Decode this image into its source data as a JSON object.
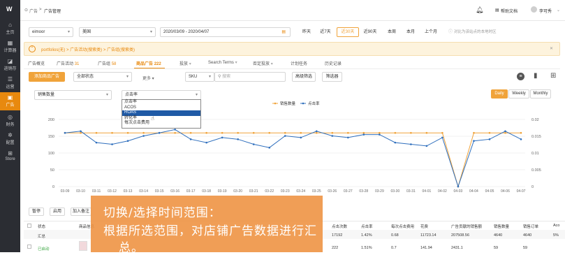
{
  "sidebar": {
    "logo": "W",
    "items": [
      {
        "label": "主页",
        "icon": "home-icon"
      },
      {
        "label": "计算器",
        "icon": "calculator-icon"
      },
      {
        "label": "进销存",
        "icon": "inventory-icon"
      },
      {
        "label": "运营",
        "icon": "operation-icon"
      },
      {
        "label": "广告",
        "icon": "megaphone-icon"
      },
      {
        "label": "财务",
        "icon": "finance-icon"
      },
      {
        "label": "配置",
        "icon": "settings-icon"
      },
      {
        "label": "Store",
        "icon": "store-icon"
      }
    ]
  },
  "breadcrumb": {
    "home": "广告",
    "sep": ">",
    "current": "广告管理"
  },
  "topbar": {
    "help": "帮助文档",
    "user": "李可秀"
  },
  "filters": {
    "shop": "eimoor",
    "country": "美国",
    "date_range": "2020/03/09 - 2020/04/07",
    "quick": [
      "昨天",
      "近7天",
      "近30天",
      "近90天",
      "本周",
      "本月",
      "上个月"
    ],
    "quick_active": "近30天",
    "compare_label": "对比为该站点的本地时区"
  },
  "banner": {
    "path": "portfolios(无) > 广告活动(搜索类) > 广告组(搜索类)"
  },
  "tabs": [
    {
      "label": "广告概览"
    },
    {
      "label": "广告活动",
      "count": "31"
    },
    {
      "label": "广告组",
      "count": "58"
    },
    {
      "label": "商品广告",
      "count": "222"
    },
    {
      "label": "投放"
    },
    {
      "label": "Search Terms"
    },
    {
      "label": "否定投放"
    },
    {
      "label": "计划任务"
    },
    {
      "label": "历史记录"
    }
  ],
  "tabs_active": "商品广告",
  "toolbar": {
    "add_btn": "添加商品广告",
    "status_select": "全部状态",
    "more": "更多",
    "sku_select": "SKU",
    "search_placeholder": "搜索",
    "advanced_btn": "高级筛选",
    "filter_btn": "筛选器"
  },
  "metric": {
    "left": "销售数量",
    "right": "点击率"
  },
  "dropdown": {
    "options": [
      "点击率",
      "ACOS",
      "ROAS",
      "转化率",
      "每次点击费用"
    ],
    "highlighted": "ROAS"
  },
  "granularity": {
    "options": [
      "Daily",
      "Weekly",
      "Monthly"
    ],
    "active": "Daily"
  },
  "chart_data": {
    "type": "line",
    "x": [
      "03-09",
      "03-10",
      "03-11",
      "03-12",
      "03-13",
      "03-14",
      "03-15",
      "03-16",
      "03-17",
      "03-18",
      "03-19",
      "03-20",
      "03-21",
      "03-22",
      "03-23",
      "03-24",
      "03-25",
      "03-26",
      "03-27",
      "03-28",
      "03-29",
      "03-30",
      "03-31",
      "04-01",
      "04-02",
      "04-03",
      "04-04",
      "04-05",
      "04-06",
      "04-07"
    ],
    "series": [
      {
        "name": "销售数量",
        "axis": "left",
        "color": "#f0a33a",
        "values": [
          160,
          160,
          160,
          160,
          160,
          160,
          160,
          160,
          160,
          160,
          160,
          160,
          160,
          160,
          160,
          160,
          160,
          160,
          160,
          160,
          160,
          160,
          160,
          160,
          160,
          0,
          160,
          160,
          160,
          160
        ]
      },
      {
        "name": "点击率",
        "axis": "right",
        "color": "#2f6fbd",
        "values": [
          0.016,
          0.0165,
          0.0131,
          0.0126,
          0.0136,
          0.0151,
          0.016,
          0.017,
          0.0141,
          0.0131,
          0.0146,
          0.0141,
          0.0126,
          0.0116,
          0.0151,
          0.0146,
          0.0165,
          0.0151,
          0.0146,
          0.0155,
          0.0155,
          0.0131,
          0.0126,
          0.0121,
          0.0146,
          0.0,
          0.0136,
          0.0141,
          0.0165,
          0.0141
        ]
      }
    ],
    "yleft": {
      "min": 0,
      "max": 200,
      "ticks": [
        "0",
        "50",
        "100",
        "150",
        "200"
      ]
    },
    "yright": {
      "min": 0,
      "max": 0.02,
      "ticks": [
        "0",
        "0.005",
        "0.01",
        "0.015",
        "0.02"
      ]
    },
    "grid": true,
    "legend": "top-center"
  },
  "table_actions": [
    "暂停",
    "启用",
    "加入备注"
  ],
  "overlay": {
    "line1": "切换/选择时间范围：",
    "line2": "根据所选范围，对店铺广告数据进行汇",
    "line3": "总。"
  },
  "table": {
    "headers": [
      "状态",
      "商品信息",
      "点击次数",
      "点击率",
      "每次点击费用",
      "花费",
      "广告贡献的销售额",
      "销售数量",
      "销售订单",
      "Aco"
    ],
    "summary": {
      "label": "汇总",
      "clicks": "17192",
      "ctr": "1.42%",
      "cpc": "0.68",
      "spend": "11723.14",
      "sales": "207508.56",
      "units": "4640",
      "orders": "4640",
      "acos": "5%"
    },
    "row": {
      "status": "已启动",
      "clicks": "222",
      "ctr": "1.51%",
      "cpc": "0.7",
      "spend": "141.94",
      "sales": "2431.1",
      "units": "59",
      "orders": "59"
    }
  }
}
